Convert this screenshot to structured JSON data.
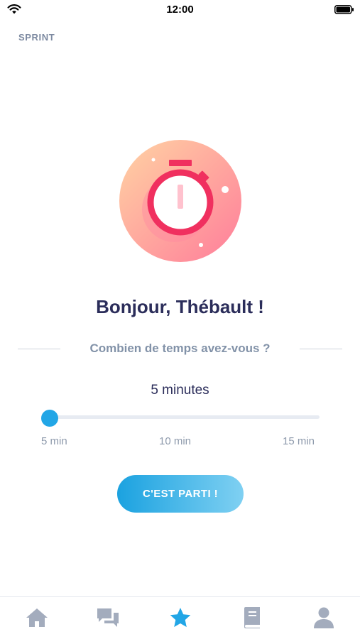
{
  "status_bar": {
    "time": "12:00",
    "icons": [
      "wifi-icon",
      "battery-icon"
    ]
  },
  "header": {
    "title": "SPRINT"
  },
  "hero": {
    "icon": "stopwatch-icon"
  },
  "greeting": "Bonjour, Thébault !",
  "question": "Combien de temps avez-vous ?",
  "duration": {
    "selected_label": "5 minutes",
    "min": 5,
    "max": 15,
    "value": 5,
    "ticks": [
      "5 min",
      "10 min",
      "15 min"
    ]
  },
  "start_button": {
    "label": "C'EST PARTI !"
  },
  "tab_bar": {
    "items": [
      {
        "icon": "home-icon",
        "active": false
      },
      {
        "icon": "chat-icon",
        "active": false
      },
      {
        "icon": "star-icon",
        "active": true
      },
      {
        "icon": "book-icon",
        "active": false
      },
      {
        "icon": "profile-icon",
        "active": false
      }
    ]
  },
  "colors": {
    "accent": "#22a6e6",
    "title": "#2b2d5a",
    "muted": "#8292a8",
    "tab_inactive": "#a3acbd",
    "stopwatch": "#f0305f"
  }
}
